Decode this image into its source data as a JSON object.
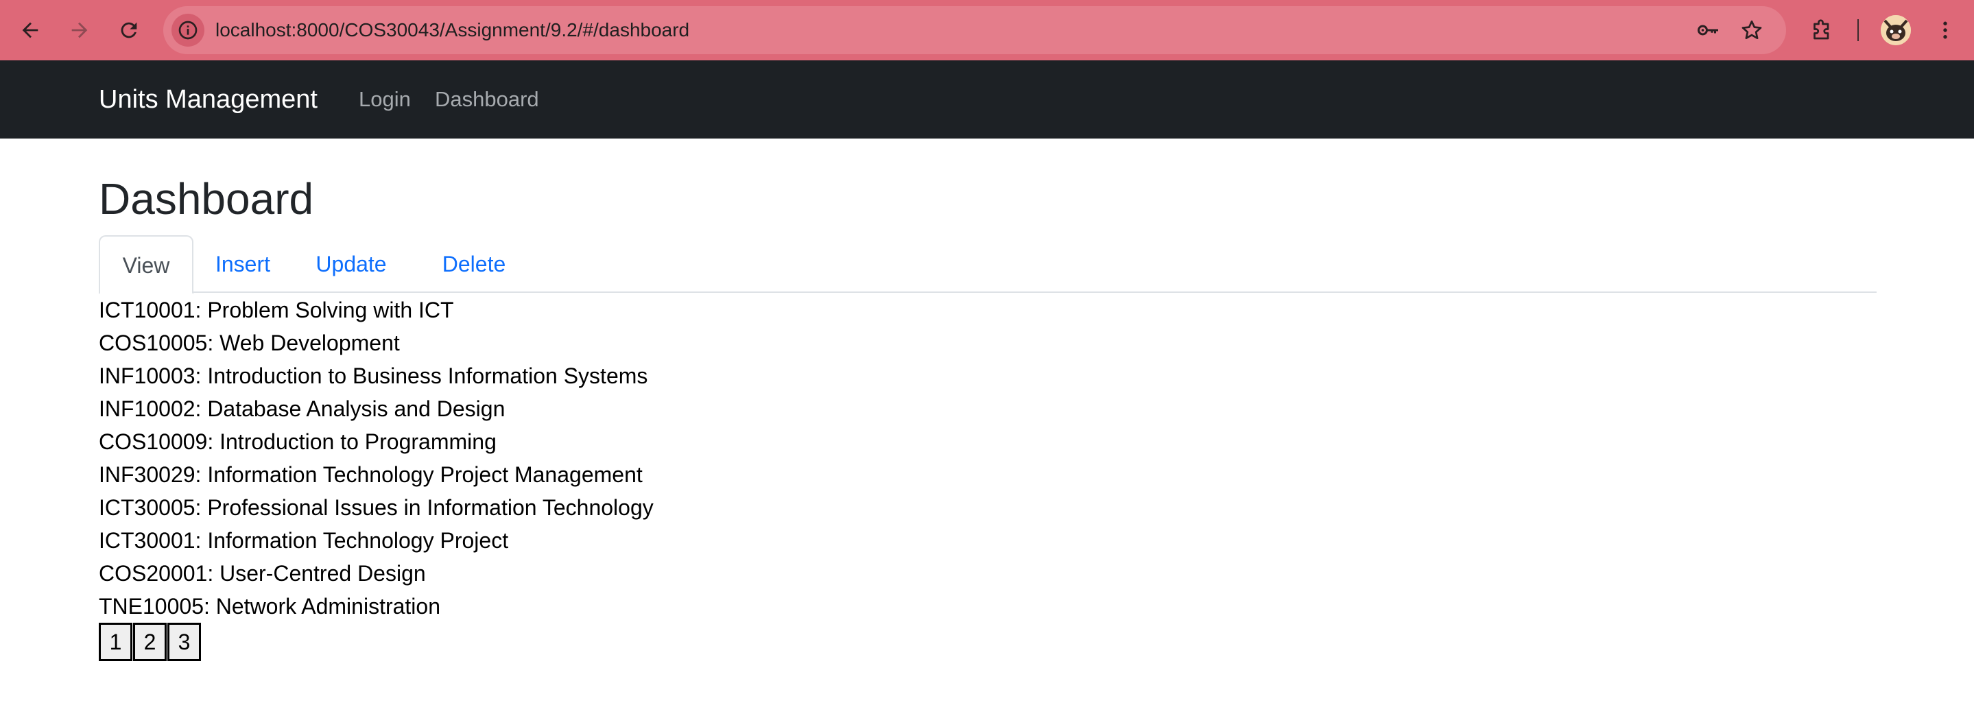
{
  "browser": {
    "url": "localhost:8000/COS30043/Assignment/9.2/#/dashboard",
    "chrome_color": "#de6878",
    "icons": {
      "back": "arrow-left-icon",
      "forward": "arrow-right-icon",
      "reload": "reload-icon",
      "site_info": "info-icon",
      "password": "key-icon",
      "bookmark": "star-icon",
      "extensions": "puzzle-icon",
      "profile": "avatar",
      "menu": "kebab-menu-icon"
    }
  },
  "navbar": {
    "brand": "Units Management",
    "links": [
      {
        "label": "Login"
      },
      {
        "label": "Dashboard"
      }
    ],
    "background": "#1d2125"
  },
  "main": {
    "title": "Dashboard",
    "tabs": [
      {
        "label": "View",
        "active": true
      },
      {
        "label": "Insert",
        "active": false
      },
      {
        "label": "Update",
        "active": false
      },
      {
        "label": "Delete",
        "active": false
      }
    ],
    "units": [
      "ICT10001: Problem Solving with ICT",
      "COS10005: Web Development",
      "INF10003: Introduction to Business Information Systems",
      "INF10002: Database Analysis and Design",
      "COS10009: Introduction to Programming",
      "INF30029: Information Technology Project Management",
      "ICT30005: Professional Issues in Information Technology",
      "ICT30001: Information Technology Project",
      "COS20001: User-Centred Design",
      "TNE10005: Network Administration"
    ],
    "pagination": [
      "1",
      "2",
      "3"
    ],
    "link_color": "#0d6efd"
  }
}
